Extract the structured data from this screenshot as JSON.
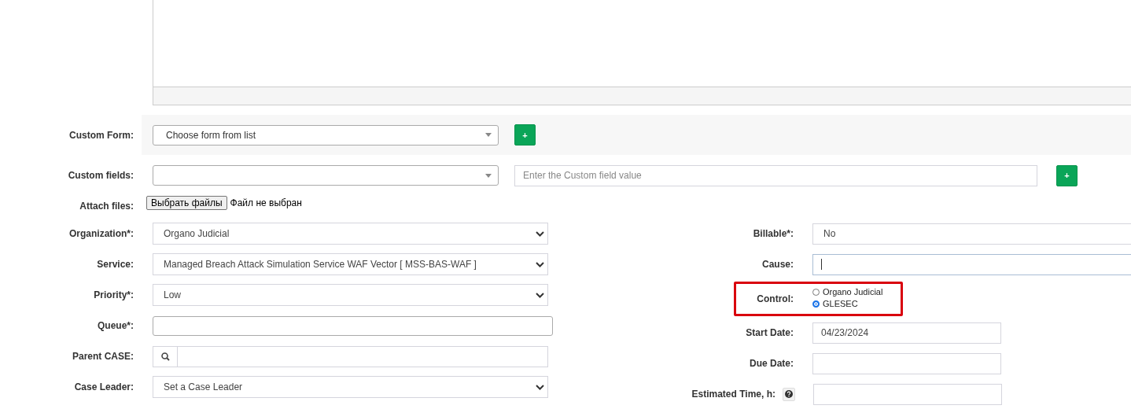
{
  "editor": {
    "kind": "textarea"
  },
  "custom_form": {
    "label": "Custom Form:",
    "placeholder": "Choose form from list",
    "add_button": "+"
  },
  "custom_fields": {
    "label": "Custom fields:",
    "value_placeholder": "Enter the Custom field value",
    "add_button": "+"
  },
  "attach_files": {
    "label": "Attach files:",
    "button": "Выбрать файлы",
    "status": "Файл не выбран"
  },
  "left_fields": [
    {
      "label": "Organization*:",
      "kind": "select",
      "value": "Organo Judicial"
    },
    {
      "label": "Service:",
      "kind": "select",
      "value": "Managed Breach Attack Simulation Service WAF Vector [ MSS-BAS-WAF ]"
    },
    {
      "label": "Priority*:",
      "kind": "select",
      "value": "Low"
    },
    {
      "label": "Queue*:",
      "kind": "input"
    },
    {
      "label": "Parent CASE:",
      "kind": "search"
    },
    {
      "label": "Case Leader:",
      "kind": "select",
      "value": "Set a Case Leader"
    }
  ],
  "right_fields": [
    {
      "label": "Billable*:",
      "kind": "wide",
      "value": "No"
    },
    {
      "label": "Cause:",
      "kind": "wide",
      "focused": true
    },
    {
      "label": "Control:",
      "kind": "radio",
      "highlighted": true,
      "options": [
        {
          "label": "Organo Judicial",
          "selected": false
        },
        {
          "label": "GLESEC",
          "selected": true
        }
      ]
    },
    {
      "label": "Start Date:",
      "kind": "date",
      "value": "04/23/2024"
    },
    {
      "label": "Due Date:",
      "kind": "date"
    },
    {
      "label": "Estimated Time, h:",
      "kind": "date",
      "help": true
    }
  ]
}
